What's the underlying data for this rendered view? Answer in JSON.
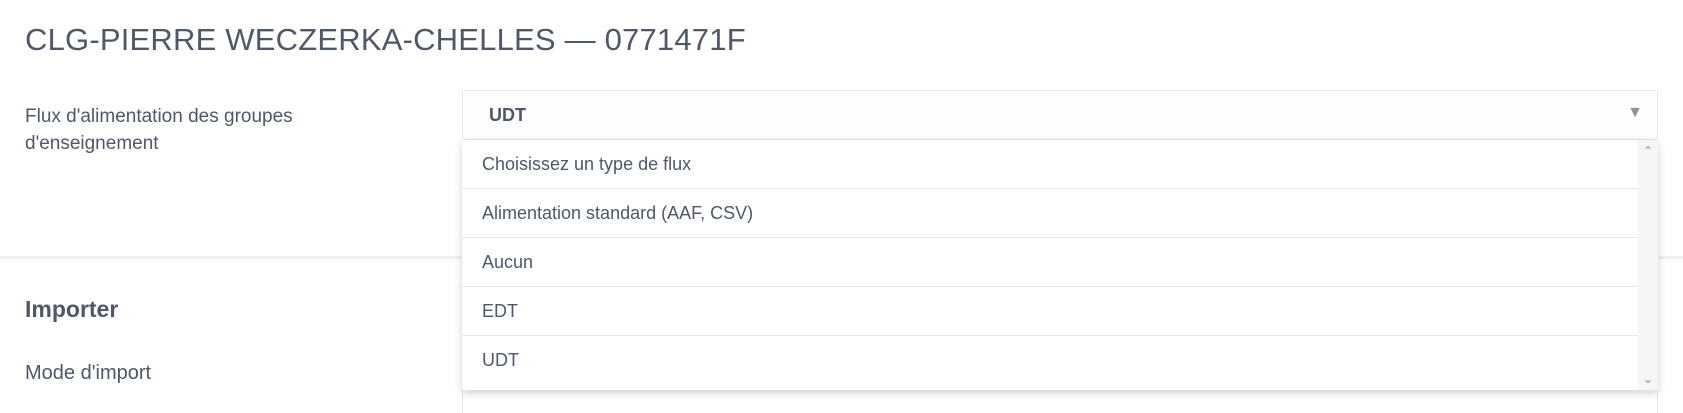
{
  "header": {
    "title": "CLG-PIERRE WECZERKA-CHELLES — 0771471F"
  },
  "flux": {
    "label": "Flux d'alimentation des groupes d'enseignement",
    "selected_value": "UDT",
    "caret": "▼",
    "options": [
      "Choisissez un type de flux",
      "Alimentation standard (AAF, CSV)",
      "Aucun",
      "EDT",
      "UDT"
    ],
    "scroll_up": "⌃",
    "scroll_down": "⌄"
  },
  "importer": {
    "title": "Importer",
    "mode_label": "Mode d'import"
  },
  "colors": {
    "text": "#4e5868",
    "accent_orange": "#e8825a",
    "border": "#e3e6ea"
  }
}
